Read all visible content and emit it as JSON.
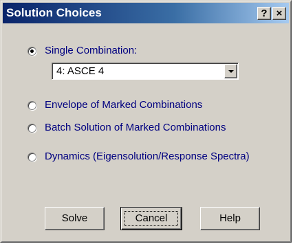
{
  "window": {
    "title": "Solution Choices",
    "help_button": "?",
    "close_button": "×"
  },
  "options": {
    "single": {
      "label": "Single Combination:",
      "selected": true
    },
    "envelope": {
      "label": "Envelope of Marked Combinations",
      "selected": false
    },
    "batch": {
      "label": "Batch Solution of Marked Combinations",
      "selected": false
    },
    "dynamics": {
      "label": "Dynamics (Eigensolution/Response Spectra)",
      "selected": false
    }
  },
  "combination_select": {
    "value": "4: ASCE 4"
  },
  "buttons": {
    "solve": "Solve",
    "cancel": "Cancel",
    "help": "Help"
  },
  "colors": {
    "title_bar_start": "#0a246a",
    "title_bar_end": "#a6caf0",
    "label_text": "#000080",
    "dialog_face": "#d4d0c8"
  }
}
